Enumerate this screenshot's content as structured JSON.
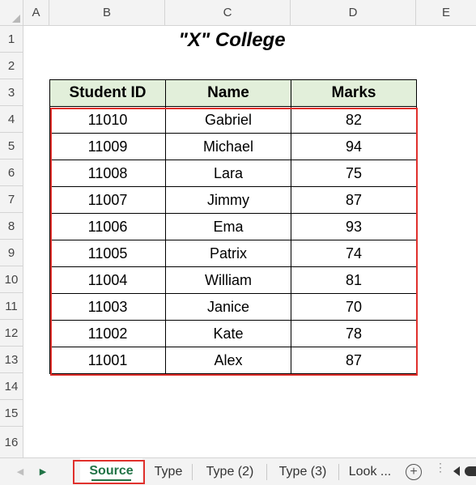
{
  "columns": [
    "A",
    "B",
    "C",
    "D",
    "E"
  ],
  "rows": [
    "1",
    "2",
    "3",
    "4",
    "5",
    "6",
    "7",
    "8",
    "9",
    "10",
    "11",
    "12",
    "13",
    "14",
    "15",
    "16"
  ],
  "title": "\"X\" College",
  "table": {
    "headers": [
      "Student ID",
      "Name",
      "Marks"
    ],
    "rows": [
      [
        "11010",
        "Gabriel",
        "82"
      ],
      [
        "11009",
        "Michael",
        "94"
      ],
      [
        "11008",
        "Lara",
        "75"
      ],
      [
        "11007",
        "Jimmy",
        "87"
      ],
      [
        "11006",
        "Ema",
        "93"
      ],
      [
        "11005",
        "Patrix",
        "74"
      ],
      [
        "11004",
        "William",
        "81"
      ],
      [
        "11003",
        "Janice",
        "70"
      ],
      [
        "11002",
        "Kate",
        "78"
      ],
      [
        "11001",
        "Alex",
        "87"
      ]
    ]
  },
  "tabs": [
    "Source",
    "Type",
    "Type (2)",
    "Type (3)",
    "Look ..."
  ],
  "active_tab": "Source",
  "icons": {
    "prev_sheet": "caret-left-icon",
    "next_sheet": "caret-right-icon",
    "add_sheet": "plus-circle-icon",
    "more": "vertical-dots-icon",
    "scroll_left": "scroll-left-icon"
  },
  "colors": {
    "header_fill": "#e2efda",
    "highlight": "#e0302c",
    "active_tab": "#217346"
  }
}
